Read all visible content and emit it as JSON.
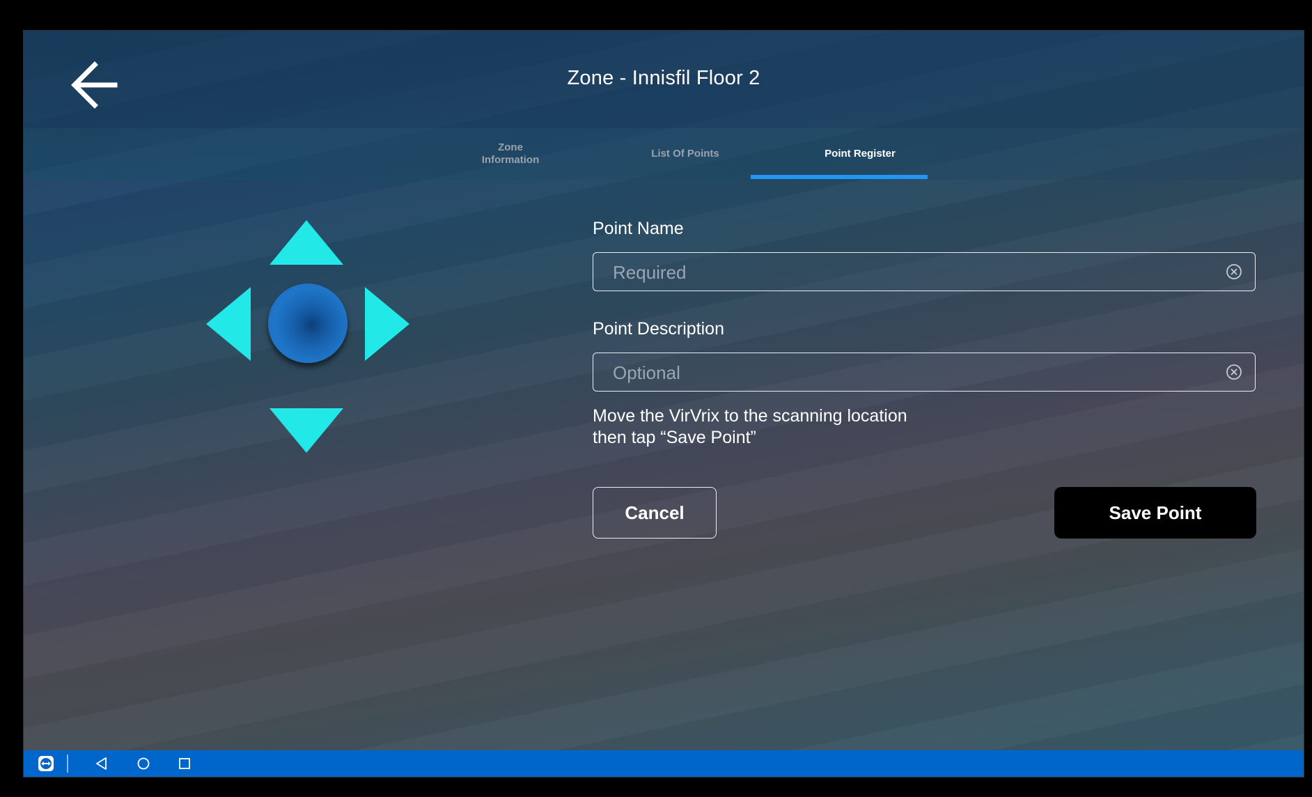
{
  "header": {
    "title": "Zone - Innisfil Floor 2",
    "back_icon": "arrow-left-icon"
  },
  "tabs": [
    {
      "label": "Zone\nInformation",
      "active": false
    },
    {
      "label": "List Of Points",
      "active": false
    },
    {
      "label": "Point Register",
      "active": true
    }
  ],
  "accent_color": "#2196f3",
  "dpad": {
    "arrow_color": "#22e8e8",
    "center_color": "#1c6fc2",
    "icons": [
      "arrow-up-icon",
      "arrow-left-icon",
      "arrow-right-icon",
      "arrow-down-icon"
    ]
  },
  "form": {
    "point_name": {
      "label": "Point Name",
      "value": "",
      "placeholder": "Required"
    },
    "point_description": {
      "label": "Point Description",
      "value": "",
      "placeholder": "Optional"
    },
    "instructions": "Move the VirVrix to the scanning location\n then tap “Save Point”",
    "cancel_label": "Cancel",
    "save_label": "Save Point"
  },
  "system_nav": {
    "bar_color": "#0066cc",
    "icons": [
      "teamviewer-icon",
      "back-triangle-icon",
      "home-circle-icon",
      "recents-square-icon"
    ]
  }
}
